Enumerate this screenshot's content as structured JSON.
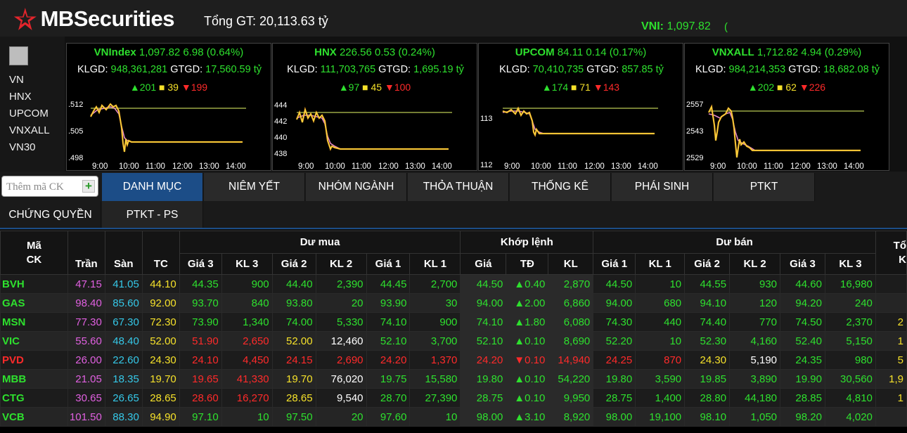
{
  "header": {
    "brand": "MBSecurities",
    "total_value": "Tổng GT: 20,113.63 tỷ",
    "ticker_name": "VNI:",
    "ticker_value": "1,097.82",
    "ticker_tail": "("
  },
  "index_list": [
    "VN",
    "HNX",
    "UPCOM",
    "VNXALL",
    "VN30"
  ],
  "panels": [
    {
      "name": "VNIndex",
      "value": "1,097.82 6.98 (0.64%)",
      "klgd_label": "KLGD:",
      "klgd": "948,361,281",
      "gtgd_label": "GTGD:",
      "gtgd": "17,560.59 tỷ",
      "up": "201",
      "eq": "39",
      "down": "199",
      "yticks": [
        ".512",
        ".505",
        ".498"
      ],
      "xticks": [
        "9:00",
        "10:00",
        "11:00",
        "12:00",
        "13:00",
        "14:00"
      ]
    },
    {
      "name": "HNX",
      "value": "226.56 0.53 (0.24%)",
      "klgd_label": "KLGD:",
      "klgd": "111,703,765",
      "gtgd_label": "GTGD:",
      "gtgd": "1,695.19 tỷ",
      "up": "97",
      "eq": "45",
      "down": "100",
      "yticks": [
        "444",
        "442",
        "440",
        "438"
      ],
      "xticks": [
        "9:00",
        "10:00",
        "11:00",
        "12:00",
        "13:00",
        "14:00"
      ]
    },
    {
      "name": "UPCOM",
      "value": "84.11 0.14 (0.17%)",
      "klgd_label": "KLGD:",
      "klgd": "70,410,735",
      "gtgd_label": "GTGD:",
      "gtgd": "857.85 tỷ",
      "up": "174",
      "eq": "71",
      "down": "143",
      "yticks": [
        "113",
        "112"
      ],
      "xticks": [
        "9:00",
        "10:00",
        "11:00",
        "12:00",
        "13:00",
        "14:00"
      ]
    },
    {
      "name": "VNXALL",
      "value": "1,712.82 4.94 (0.29%)",
      "klgd_label": "KLGD:",
      "klgd": "984,214,353",
      "gtgd_label": "GTGD:",
      "gtgd": "18,682.08 tỷ",
      "up": "202",
      "eq": "62",
      "down": "226",
      "yticks": [
        "2557",
        "2543",
        "2529"
      ],
      "xticks": [
        "9:00",
        "10:00",
        "11:00",
        "12:00",
        "13:00",
        "14:00"
      ]
    }
  ],
  "search": {
    "placeholder": "Thêm mã CK"
  },
  "tabs": [
    "DANH MỤC",
    "NIÊM YẾT",
    "NHÓM NGÀNH",
    "THỎA THUẬN",
    "THỐNG KÊ",
    "PHÁI SINH",
    "PTKT"
  ],
  "subtabs": [
    "CHỨNG QUYỀN",
    "PTKT - PS"
  ],
  "table": {
    "group_headers": {
      "code": "Mã\nCK",
      "bid": "Dư mua",
      "match": "Khớp lệnh",
      "ask": "Dư bán",
      "total": "Tổ\nK"
    },
    "columns": [
      "Trần",
      "Sàn",
      "TC",
      "Giá 3",
      "KL 3",
      "Giá 2",
      "KL 2",
      "Giá 1",
      "KL 1",
      "Giá",
      "TĐ",
      "KL",
      "Giá 1",
      "KL 1",
      "Giá 2",
      "KL 2",
      "Giá 3",
      "KL 3"
    ],
    "rows": [
      {
        "sym": "BVH",
        "c": [
          "47.15",
          "41.05",
          "44.10",
          "44.35",
          "900",
          "44.40",
          "2,390",
          "44.45",
          "2,700",
          "44.50",
          "▲0.40",
          "2,870",
          "44.50",
          "10",
          "44.55",
          "930",
          "44.60",
          "16,980",
          ""
        ],
        "cls": [
          "ceil",
          "floor",
          "ref",
          "g",
          "g",
          "g",
          "g",
          "g",
          "g",
          "g",
          "g",
          "g",
          "g",
          "g",
          "g",
          "g",
          "g",
          "g",
          "w"
        ]
      },
      {
        "sym": "GAS",
        "c": [
          "98.40",
          "85.60",
          "92.00",
          "93.70",
          "840",
          "93.80",
          "20",
          "93.90",
          "30",
          "94.00",
          "▲2.00",
          "6,860",
          "94.00",
          "680",
          "94.10",
          "120",
          "94.20",
          "240",
          ""
        ],
        "cls": [
          "ceil",
          "floor",
          "ref",
          "g",
          "g",
          "g",
          "g",
          "g",
          "g",
          "g",
          "g",
          "g",
          "g",
          "g",
          "g",
          "g",
          "g",
          "g",
          "w"
        ]
      },
      {
        "sym": "MSN",
        "c": [
          "77.30",
          "67.30",
          "72.30",
          "73.90",
          "1,340",
          "74.00",
          "5,330",
          "74.10",
          "900",
          "74.10",
          "▲1.80",
          "6,080",
          "74.30",
          "440",
          "74.40",
          "770",
          "74.50",
          "2,370",
          "2"
        ],
        "cls": [
          "ceil",
          "floor",
          "ref",
          "g",
          "g",
          "g",
          "g",
          "g",
          "g",
          "g",
          "g",
          "g",
          "g",
          "g",
          "g",
          "g",
          "g",
          "g",
          "y"
        ]
      },
      {
        "sym": "VIC",
        "c": [
          "55.60",
          "48.40",
          "52.00",
          "51.90",
          "2,650",
          "52.00",
          "12,460",
          "52.10",
          "3,700",
          "52.10",
          "▲0.10",
          "8,690",
          "52.20",
          "10",
          "52.30",
          "4,160",
          "52.40",
          "5,150",
          "1"
        ],
        "cls": [
          "ceil",
          "floor",
          "ref",
          "r",
          "r",
          "y",
          "w",
          "g",
          "g",
          "g",
          "g",
          "g",
          "g",
          "g",
          "g",
          "g",
          "g",
          "g",
          "y"
        ]
      },
      {
        "sym": "PVD",
        "c": [
          "26.00",
          "22.60",
          "24.30",
          "24.10",
          "4,450",
          "24.15",
          "2,690",
          "24.20",
          "1,370",
          "24.20",
          "▼0.10",
          "14,940",
          "24.25",
          "870",
          "24.30",
          "5,190",
          "24.35",
          "980",
          "5"
        ],
        "cls": [
          "ceil",
          "floor",
          "ref",
          "r",
          "r",
          "r",
          "r",
          "r",
          "r",
          "r",
          "r",
          "r",
          "r",
          "r",
          "y",
          "w",
          "g",
          "g",
          "y"
        ]
      },
      {
        "sym": "MBB",
        "c": [
          "21.05",
          "18.35",
          "19.70",
          "19.65",
          "41,330",
          "19.70",
          "76,020",
          "19.75",
          "15,580",
          "19.80",
          "▲0.10",
          "54,220",
          "19.80",
          "3,590",
          "19.85",
          "3,890",
          "19.90",
          "30,560",
          "1,9"
        ],
        "cls": [
          "ceil",
          "floor",
          "ref",
          "r",
          "r",
          "y",
          "w",
          "g",
          "g",
          "g",
          "g",
          "g",
          "g",
          "g",
          "g",
          "g",
          "g",
          "g",
          "y"
        ]
      },
      {
        "sym": "CTG",
        "c": [
          "30.65",
          "26.65",
          "28.65",
          "28.60",
          "16,270",
          "28.65",
          "9,540",
          "28.70",
          "27,390",
          "28.75",
          "▲0.10",
          "9,950",
          "28.75",
          "1,400",
          "28.80",
          "44,180",
          "28.85",
          "4,810",
          "1"
        ],
        "cls": [
          "ceil",
          "floor",
          "ref",
          "r",
          "r",
          "y",
          "w",
          "g",
          "g",
          "g",
          "g",
          "g",
          "g",
          "g",
          "g",
          "g",
          "g",
          "g",
          "y"
        ]
      },
      {
        "sym": "VCB",
        "c": [
          "101.50",
          "88.30",
          "94.90",
          "97.10",
          "10",
          "97.50",
          "20",
          "97.60",
          "10",
          "98.00",
          "▲3.10",
          "8,920",
          "98.00",
          "19,100",
          "98.10",
          "1,050",
          "98.20",
          "4,020",
          ""
        ],
        "cls": [
          "ceil",
          "floor",
          "ref",
          "g",
          "g",
          "g",
          "g",
          "g",
          "g",
          "g",
          "g",
          "g",
          "g",
          "g",
          "g",
          "g",
          "g",
          "g",
          "w"
        ]
      }
    ],
    "sym_colors": {
      "BVH": "g",
      "GAS": "g",
      "MSN": "g",
      "VIC": "g",
      "PVD": "r",
      "MBB": "g",
      "CTG": "g",
      "VCB": "g"
    }
  },
  "colors": {
    "accent": "#1c4d87",
    "up": "#2ee02e",
    "down": "#ff2a2a",
    "ref": "#f5e12a",
    "ceil": "#e060e0",
    "floor": "#35c8e8"
  }
}
